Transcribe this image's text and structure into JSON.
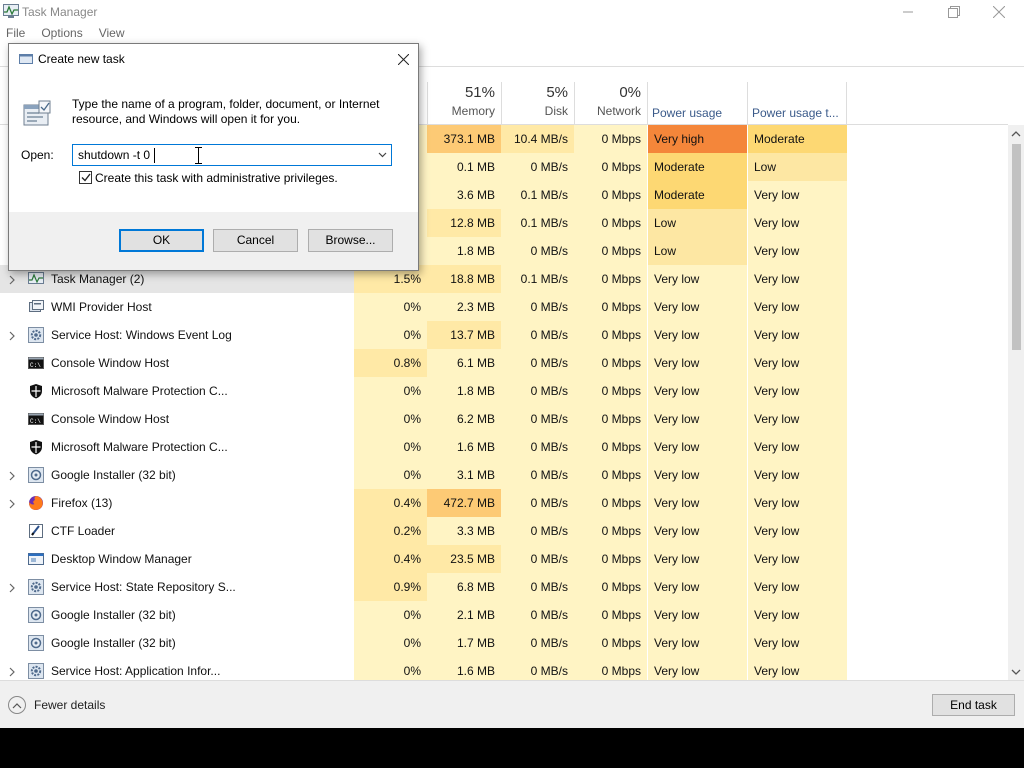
{
  "window": {
    "title": "Task Manager",
    "menu": [
      "File",
      "Options",
      "View"
    ]
  },
  "columns": {
    "memory": {
      "pct": "51%",
      "label": "Memory"
    },
    "disk": {
      "pct": "5%",
      "label": "Disk"
    },
    "network": {
      "pct": "0%",
      "label": "Network"
    },
    "power": {
      "label": "Power usage"
    },
    "power_trend": {
      "label": "Power usage t..."
    }
  },
  "colors": {
    "very_high": "#f4863a",
    "moderate": "#fdd873",
    "low": "#fde7a3",
    "very_low": "#fff4c4",
    "cell_light": "#fff4c4",
    "cell_mid": "#ffe9a6",
    "cell_hot": "#fdca75",
    "accent": "#0078d7"
  },
  "processes": [
    {
      "name": "",
      "icon": "",
      "expandable": false,
      "cpu": "",
      "memory": "373.1 MB",
      "disk": "10.4 MB/s",
      "network": "0 Mbps",
      "power": "Very high",
      "power_trend": "Moderate"
    },
    {
      "name": "",
      "icon": "",
      "expandable": false,
      "cpu": "",
      "memory": "0.1 MB",
      "disk": "0 MB/s",
      "network": "0 Mbps",
      "power": "Moderate",
      "power_trend": "Low"
    },
    {
      "name": "",
      "icon": "",
      "expandable": false,
      "cpu": "",
      "memory": "3.6 MB",
      "disk": "0.1 MB/s",
      "network": "0 Mbps",
      "power": "Moderate",
      "power_trend": "Very low"
    },
    {
      "name": "",
      "icon": "",
      "expandable": false,
      "cpu": "",
      "memory": "12.8 MB",
      "disk": "0.1 MB/s",
      "network": "0 Mbps",
      "power": "Low",
      "power_trend": "Very low"
    },
    {
      "name": "",
      "icon": "",
      "expandable": false,
      "cpu": "",
      "memory": "1.8 MB",
      "disk": "0 MB/s",
      "network": "0 Mbps",
      "power": "Low",
      "power_trend": "Very low"
    },
    {
      "name": "Task Manager (2)",
      "icon": "task-manager-icon",
      "expandable": true,
      "selected": true,
      "cpu": "1.5%",
      "memory": "18.8 MB",
      "disk": "0.1 MB/s",
      "network": "0 Mbps",
      "power": "Very low",
      "power_trend": "Very low"
    },
    {
      "name": "WMI Provider Host",
      "icon": "wmi-icon",
      "expandable": false,
      "cpu": "0%",
      "memory": "2.3 MB",
      "disk": "0 MB/s",
      "network": "0 Mbps",
      "power": "Very low",
      "power_trend": "Very low"
    },
    {
      "name": "Service Host: Windows Event Log",
      "icon": "gear-icon",
      "expandable": true,
      "cpu": "0%",
      "memory": "13.7 MB",
      "disk": "0 MB/s",
      "network": "0 Mbps",
      "power": "Very low",
      "power_trend": "Very low"
    },
    {
      "name": "Console Window Host",
      "icon": "console-icon",
      "expandable": false,
      "cpu": "0.8%",
      "memory": "6.1 MB",
      "disk": "0 MB/s",
      "network": "0 Mbps",
      "power": "Very low",
      "power_trend": "Very low"
    },
    {
      "name": "Microsoft Malware Protection C...",
      "icon": "shield-icon",
      "expandable": false,
      "cpu": "0%",
      "memory": "1.8 MB",
      "disk": "0 MB/s",
      "network": "0 Mbps",
      "power": "Very low",
      "power_trend": "Very low"
    },
    {
      "name": "Console Window Host",
      "icon": "console-icon",
      "expandable": false,
      "cpu": "0%",
      "memory": "6.2 MB",
      "disk": "0 MB/s",
      "network": "0 Mbps",
      "power": "Very low",
      "power_trend": "Very low"
    },
    {
      "name": "Microsoft Malware Protection C...",
      "icon": "shield-icon",
      "expandable": false,
      "cpu": "0%",
      "memory": "1.6 MB",
      "disk": "0 MB/s",
      "network": "0 Mbps",
      "power": "Very low",
      "power_trend": "Very low"
    },
    {
      "name": "Google Installer (32 bit)",
      "icon": "installer-icon",
      "expandable": true,
      "cpu": "0%",
      "memory": "3.1 MB",
      "disk": "0 MB/s",
      "network": "0 Mbps",
      "power": "Very low",
      "power_trend": "Very low"
    },
    {
      "name": "Firefox (13)",
      "icon": "firefox-icon",
      "expandable": true,
      "cpu": "0.4%",
      "memory": "472.7 MB",
      "disk": "0 MB/s",
      "network": "0 Mbps",
      "power": "Very low",
      "power_trend": "Very low"
    },
    {
      "name": "CTF Loader",
      "icon": "ctf-icon",
      "expandable": false,
      "cpu": "0.2%",
      "memory": "3.3 MB",
      "disk": "0 MB/s",
      "network": "0 Mbps",
      "power": "Very low",
      "power_trend": "Very low"
    },
    {
      "name": "Desktop Window Manager",
      "icon": "dwm-icon",
      "expandable": false,
      "cpu": "0.4%",
      "memory": "23.5 MB",
      "disk": "0 MB/s",
      "network": "0 Mbps",
      "power": "Very low",
      "power_trend": "Very low"
    },
    {
      "name": "Service Host: State Repository S...",
      "icon": "gear-icon",
      "expandable": true,
      "cpu": "0.9%",
      "memory": "6.8 MB",
      "disk": "0 MB/s",
      "network": "0 Mbps",
      "power": "Very low",
      "power_trend": "Very low"
    },
    {
      "name": "Google Installer (32 bit)",
      "icon": "installer-icon",
      "expandable": false,
      "cpu": "0%",
      "memory": "2.1 MB",
      "disk": "0 MB/s",
      "network": "0 Mbps",
      "power": "Very low",
      "power_trend": "Very low"
    },
    {
      "name": "Google Installer (32 bit)",
      "icon": "installer-icon",
      "expandable": false,
      "cpu": "0%",
      "memory": "1.7 MB",
      "disk": "0 MB/s",
      "network": "0 Mbps",
      "power": "Very low",
      "power_trend": "Very low"
    },
    {
      "name": "Service Host: Application Infor...",
      "icon": "gear-icon",
      "expandable": true,
      "cpu": "0%",
      "memory": "1.6 MB",
      "disk": "0 MB/s",
      "network": "0 Mbps",
      "power": "Very low",
      "power_trend": "Very low"
    }
  ],
  "footer": {
    "fewer_details": "Fewer details",
    "end_task": "End task"
  },
  "dialog": {
    "title": "Create new task",
    "description": "Type the name of a program, folder, document, or Internet resource, and Windows will open it for you.",
    "open_label": "Open:",
    "open_value": "shutdown -t 0",
    "admin_label": "Create this task with administrative privileges.",
    "admin_checked": true,
    "ok": "OK",
    "cancel": "Cancel",
    "browse": "Browse..."
  }
}
